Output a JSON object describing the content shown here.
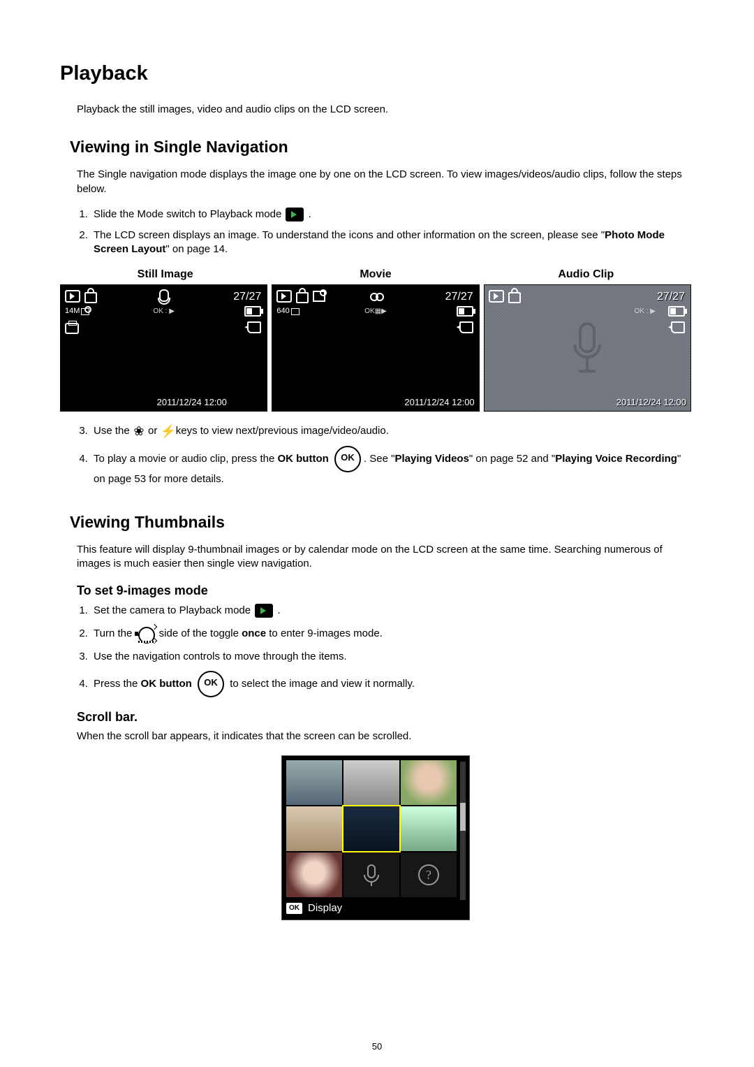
{
  "title": "Playback",
  "intro": "Playback the still images, video and audio clips on the LCD screen.",
  "section1": {
    "heading": "Viewing in Single Navigation",
    "body": "The Single navigation mode displays the image one by one on the LCD screen. To view images/videos/audio clips, follow the steps below.",
    "steps": {
      "s1a": "Slide the Mode switch to Playback mode ",
      "s1b": ".",
      "s2a": "The LCD screen displays an image. To understand the icons and other information on the screen, please see \"",
      "s2bold": "Photo Mode Screen Layout",
      "s2b": "\" on page 14.",
      "s3a": "Use the ",
      "s3b": " or ",
      "s3c": " keys to view next/previous image/video/audio.",
      "s4a": "To play a movie or audio clip, press the ",
      "s4bold1": "OK button",
      "s4b": " . See \"",
      "s4bold2": "Playing Videos",
      "s4c": "\" on page 52 and \"",
      "s4bold3": "Playing Voice Recording",
      "s4d": "\" on page 53 for more details."
    },
    "screens": {
      "h1": "Still Image",
      "h2": "Movie",
      "h3": "Audio Clip",
      "counter": "27/27",
      "timestamp": "2011/12/24 12:00",
      "ok_hint": "OK : ▶",
      "ok_play_hint": "OK▦▶",
      "size14m": "14M",
      "size640": "640"
    }
  },
  "section2": {
    "heading": "Viewing Thumbnails",
    "body": "This feature will display 9-thumbnail images or by calendar mode on the LCD screen at the same time. Searching numerous of images is much easier then single view navigation.",
    "sub1": {
      "heading": "To set 9-images mode",
      "s1a": "Set the camera to Playback mode ",
      "s1b": ".",
      "s2a": "Turn the ",
      "s2b": " side of the toggle ",
      "s2bold": "once",
      "s2c": " to enter 9-images mode.",
      "s3": "Use the navigation controls to move through the items.",
      "s4a": "Press the ",
      "s4bold": "OK button",
      "s4b": "  to select the image and view it normally."
    },
    "sub2": {
      "heading": "Scroll bar.",
      "body": "When the scroll bar appears, it indicates that the screen can be scrolled.",
      "ok_label": "OK",
      "display_label": "Display"
    }
  },
  "page_number": "50"
}
